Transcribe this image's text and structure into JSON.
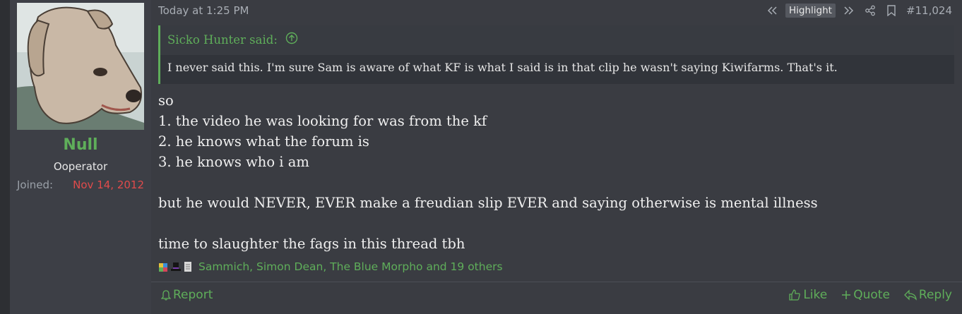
{
  "user": {
    "name": "Null",
    "title": "Ooperator",
    "joined_label": "Joined:",
    "joined_value": "Nov 14, 2012"
  },
  "post": {
    "timestamp": "Today at 1:25 PM",
    "highlight_label": "Highlight",
    "post_number": "#11,024",
    "quote": {
      "author": "Sicko Hunter said:",
      "text": "I never said this. I'm sure Sam is aware of what KF is what I said is in that clip he wasn't saying Kiwifarms. That's it."
    },
    "lines": [
      "so",
      "1. the video he was looking for was from the kf",
      "2. he knows what the forum is",
      "3. he knows who i am",
      "",
      "but he would NEVER, EVER make a freudian slip EVER and saying otherwise is mental illness",
      "",
      "time to slaughter the fags in this thread tbh"
    ],
    "reactions_text": "Sammich, Simon Dean, The Blue Morpho and 19 others"
  },
  "footer": {
    "report": "Report",
    "like": "Like",
    "quote": "Quote",
    "reply": "Reply"
  },
  "colors": {
    "accent": "#5fae5a",
    "joined_date": "#e04b4b",
    "background": "#3a3c42"
  },
  "icons": [
    "rewind-icon",
    "fast-forward-icon",
    "share-icon",
    "bookmark-icon",
    "arrow-up-circle-icon",
    "bell-icon",
    "thumbs-up-icon",
    "plus-icon",
    "reply-icon"
  ]
}
